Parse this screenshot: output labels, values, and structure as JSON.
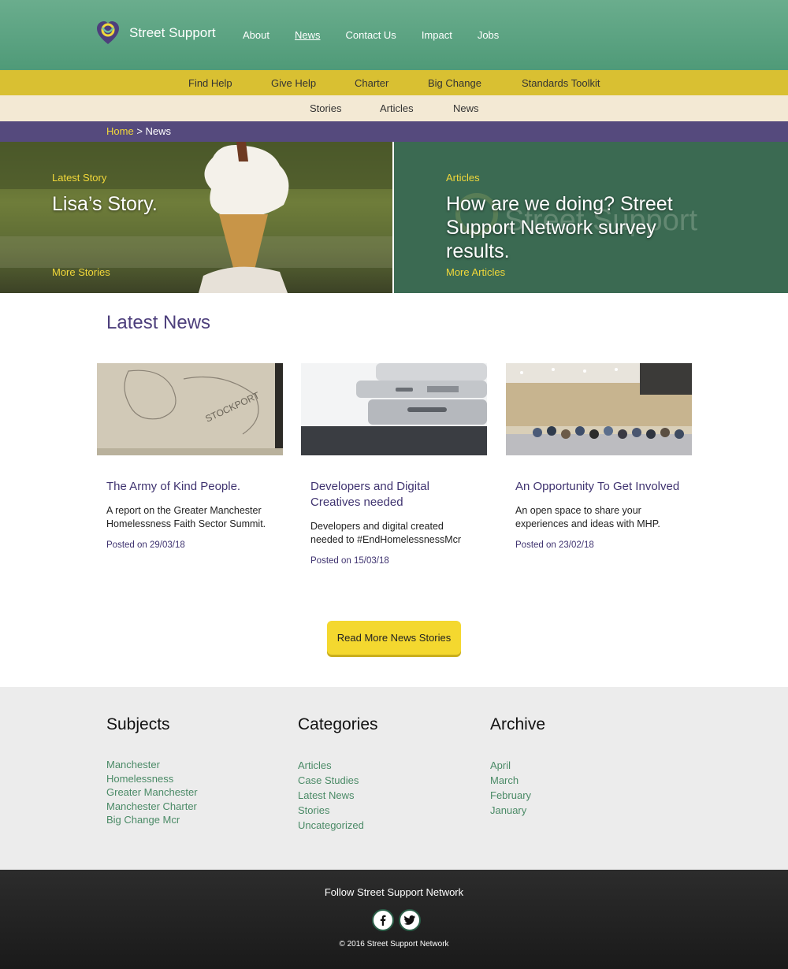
{
  "header": {
    "brand": "Street Support",
    "nav": [
      "About",
      "News",
      "Contact Us",
      "Impact",
      "Jobs"
    ],
    "active_nav": "News"
  },
  "subnav": [
    "Find Help",
    "Give Help",
    "Charter",
    "Big Change",
    "Standards Toolkit"
  ],
  "tertnav": [
    "Stories",
    "Articles",
    "News"
  ],
  "breadcrumb": {
    "home": "Home",
    "separator": ">",
    "current": "News"
  },
  "hero": {
    "left": {
      "eyebrow": "Latest Story",
      "title": "Lisa’s Story.",
      "more": "More Stories"
    },
    "right": {
      "eyebrow": "Articles",
      "title": "How are we doing? Street Support Network survey results.",
      "more": "More Articles"
    }
  },
  "latest_news": {
    "title": "Latest News",
    "cards": [
      {
        "title": "The Army of Kind People.",
        "desc": "A report on the Greater Manchester Homelessness Faith Sector Summit.",
        "date": "Posted on 29/03/18"
      },
      {
        "title": "Developers and Digital Creatives needed",
        "desc": "Developers and digital created needed to #EndHomelessnessMcr",
        "date": "Posted on 15/03/18"
      },
      {
        "title": "An Opportunity To Get Involved",
        "desc": "An open space to share your experiences and ideas with MHP.",
        "date": "Posted on 23/02/18"
      }
    ],
    "cta": "Read More News Stories"
  },
  "footer": {
    "subjects": {
      "title": "Subjects",
      "items": [
        "Manchester",
        "Homelessness",
        "Greater Manchester",
        "Manchester Charter",
        "Big Change Mcr"
      ]
    },
    "categories": {
      "title": "Categories",
      "items": [
        "Articles",
        "Case Studies",
        "Latest News",
        "Stories",
        "Uncategorized"
      ]
    },
    "archive": {
      "title": "Archive",
      "items": [
        "April",
        "March",
        "February",
        "January"
      ]
    },
    "follow": "Follow Street Support Network",
    "copyright": "© 2016 Street Support Network"
  },
  "colors": {
    "header": "#5fa684",
    "subnav": "#d9c032",
    "tertnav": "#f3e9d4",
    "breadcrumb": "#554a7d",
    "accent_yellow": "#f2d83a",
    "heading_purple": "#4d3f7c",
    "link_green": "#4a8a66"
  }
}
